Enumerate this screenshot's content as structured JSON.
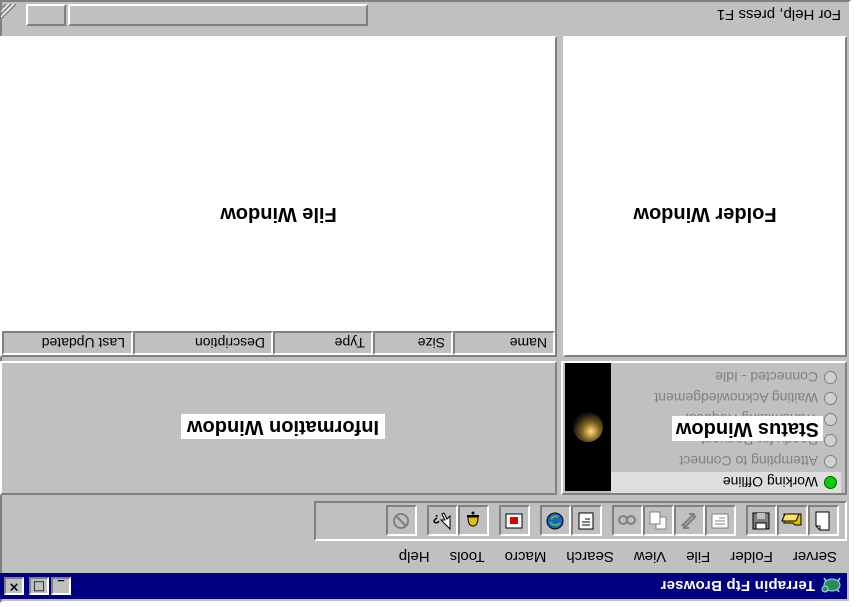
{
  "window": {
    "title": "Terrapin Ftp Browser",
    "controls": {
      "minimize": "_",
      "maximize": "□",
      "close": "×"
    }
  },
  "menu": [
    "Server",
    "Folder",
    "File",
    "View",
    "Search",
    "Macro",
    "Tools",
    "Help"
  ],
  "toolbar": {
    "icons": [
      "new-document-icon",
      "open-folder-icon",
      "save-icon",
      "view-icon",
      "transfer-icon",
      "copy-icon",
      "find-icon",
      "properties-icon",
      "refresh-icon",
      "stop-record-icon",
      "bell-icon",
      "context-help-icon",
      "cancel-icon"
    ]
  },
  "status": {
    "label": "Status Window",
    "items": [
      {
        "text": "Working Offline",
        "active": true
      },
      {
        "text": "Attempting to Connect",
        "active": false
      },
      {
        "text": "Ready for Request",
        "active": false
      },
      {
        "text": "Transmitting Request",
        "active": false
      },
      {
        "text": "Waiting Acknowledgement",
        "active": false
      },
      {
        "text": "Connected - Idle",
        "active": false
      }
    ]
  },
  "info": {
    "label": "Information Window"
  },
  "folder": {
    "label": "Folder Window"
  },
  "file": {
    "label": "File Window",
    "columns": [
      "Name",
      "Size",
      "Type",
      "Description",
      "Last Updated"
    ]
  },
  "statusbar": {
    "message": "For Help, press F1"
  },
  "colors": {
    "titlebar": "#000080",
    "face": "#c0c0c0",
    "active_light": "#00d000"
  }
}
